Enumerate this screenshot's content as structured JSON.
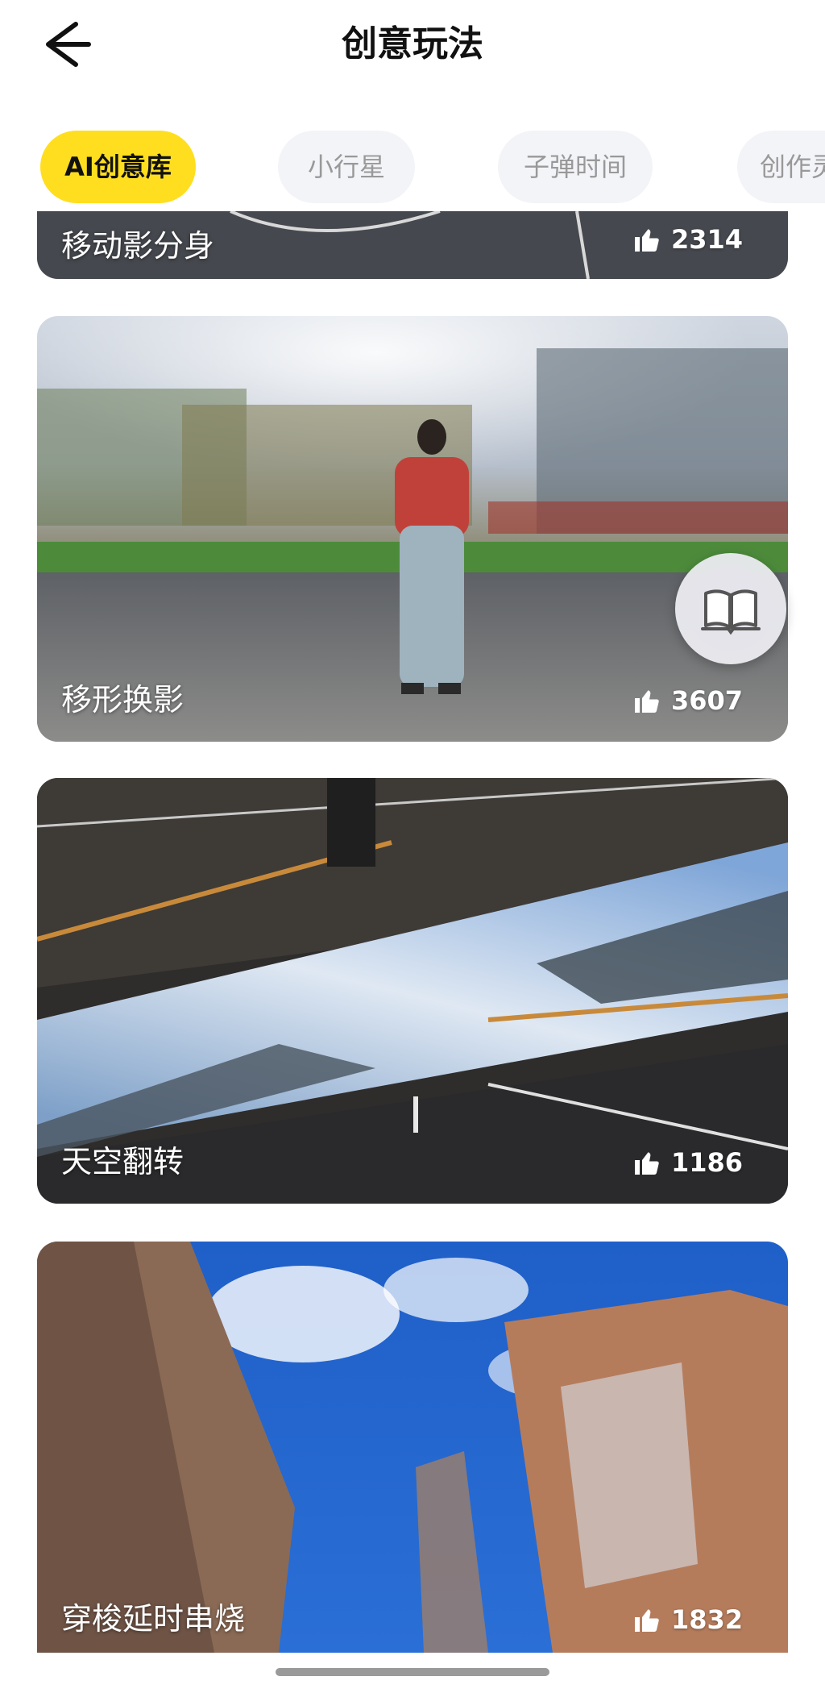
{
  "header": {
    "title": "创意玩法",
    "back_icon": "arrow-left-icon"
  },
  "tabs": [
    {
      "label": "AI创意库",
      "active": true
    },
    {
      "label": "小行星",
      "active": false
    },
    {
      "label": "子弹时间",
      "active": false
    },
    {
      "label": "创作灵",
      "active": false
    }
  ],
  "cards": [
    {
      "label": "移动影分身",
      "likes": "2314"
    },
    {
      "label": "移形换影",
      "likes": "3607"
    },
    {
      "label": "天空翻转",
      "likes": "1186"
    },
    {
      "label": "穿梭延时串烧",
      "likes": "1832"
    }
  ],
  "floating_button": {
    "icon": "book-icon"
  },
  "colors": {
    "accent": "#ffde1f",
    "tab_inactive_bg": "#f3f4f8",
    "tab_inactive_text": "#999999"
  }
}
